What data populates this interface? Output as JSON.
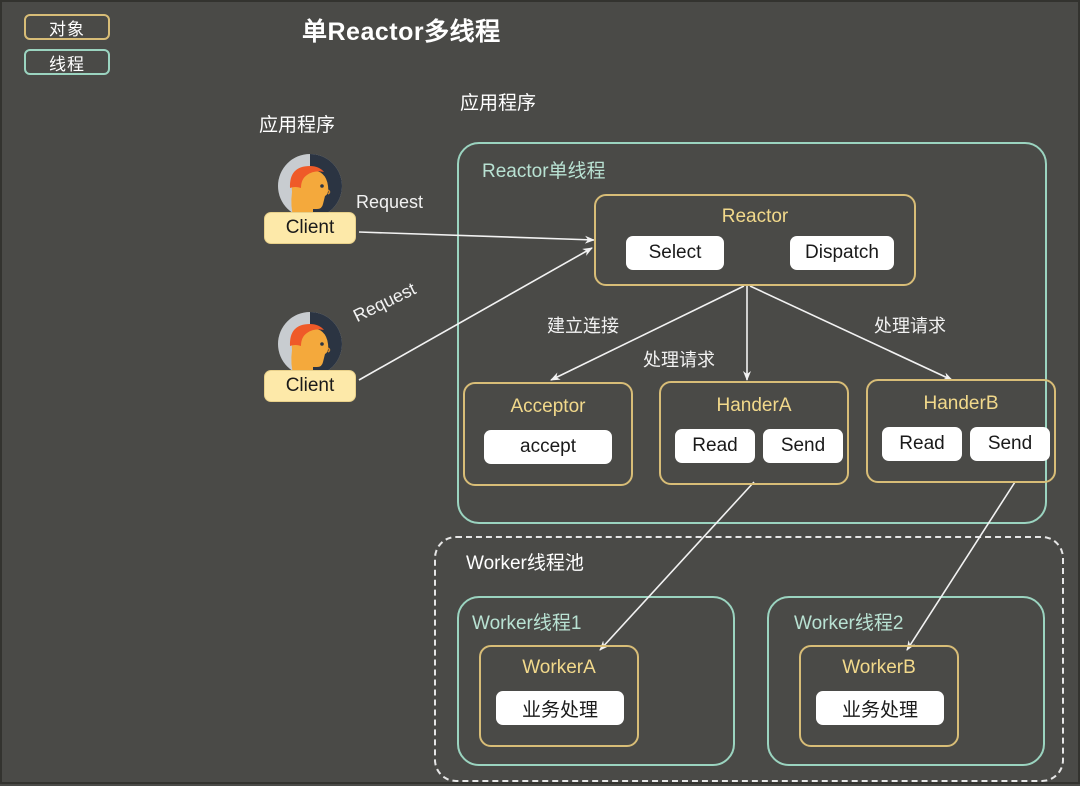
{
  "title": "单Reactor多线程",
  "colors": {
    "background": "#4a4a47",
    "object_border": "#d8bd77",
    "object_title": "#f2d98b",
    "thread_border": "#9bd4c0",
    "thread_title": "#b9e2d3",
    "pill_background": "#ffffff",
    "client_background": "#fde9a9",
    "arrow": "#f2f2f2",
    "text": "#ffffff"
  },
  "legend": {
    "object": "对象",
    "thread": "线程"
  },
  "captions": {
    "app_left": "应用程序",
    "app_right": "应用程序"
  },
  "clients": [
    {
      "label": "Client",
      "icon": "user-avatar-icon"
    },
    {
      "label": "Client",
      "icon": "user-avatar-icon"
    }
  ],
  "arrow_labels": {
    "request_1": "Request",
    "request_2": "Request",
    "establish_connection": "建立连接",
    "process_request_1": "处理请求",
    "process_request_2": "处理请求"
  },
  "reactor_thread": {
    "title": "Reactor单线程",
    "reactor": {
      "title": "Reactor",
      "actions": [
        "Select",
        "Dispatch"
      ]
    },
    "acceptor": {
      "title": "Acceptor",
      "actions": [
        "accept"
      ]
    },
    "handlers": [
      {
        "title": "HanderA",
        "actions": [
          "Read",
          "Send"
        ]
      },
      {
        "title": "HanderB",
        "actions": [
          "Read",
          "Send"
        ]
      }
    ]
  },
  "worker_pool": {
    "title": "Worker线程池",
    "threads": [
      {
        "title": "Worker线程1",
        "worker": {
          "title": "WorkerA",
          "actions": [
            "业务处理"
          ]
        }
      },
      {
        "title": "Worker线程2",
        "worker": {
          "title": "WorkerB",
          "actions": [
            "业务处理"
          ]
        }
      }
    ]
  }
}
